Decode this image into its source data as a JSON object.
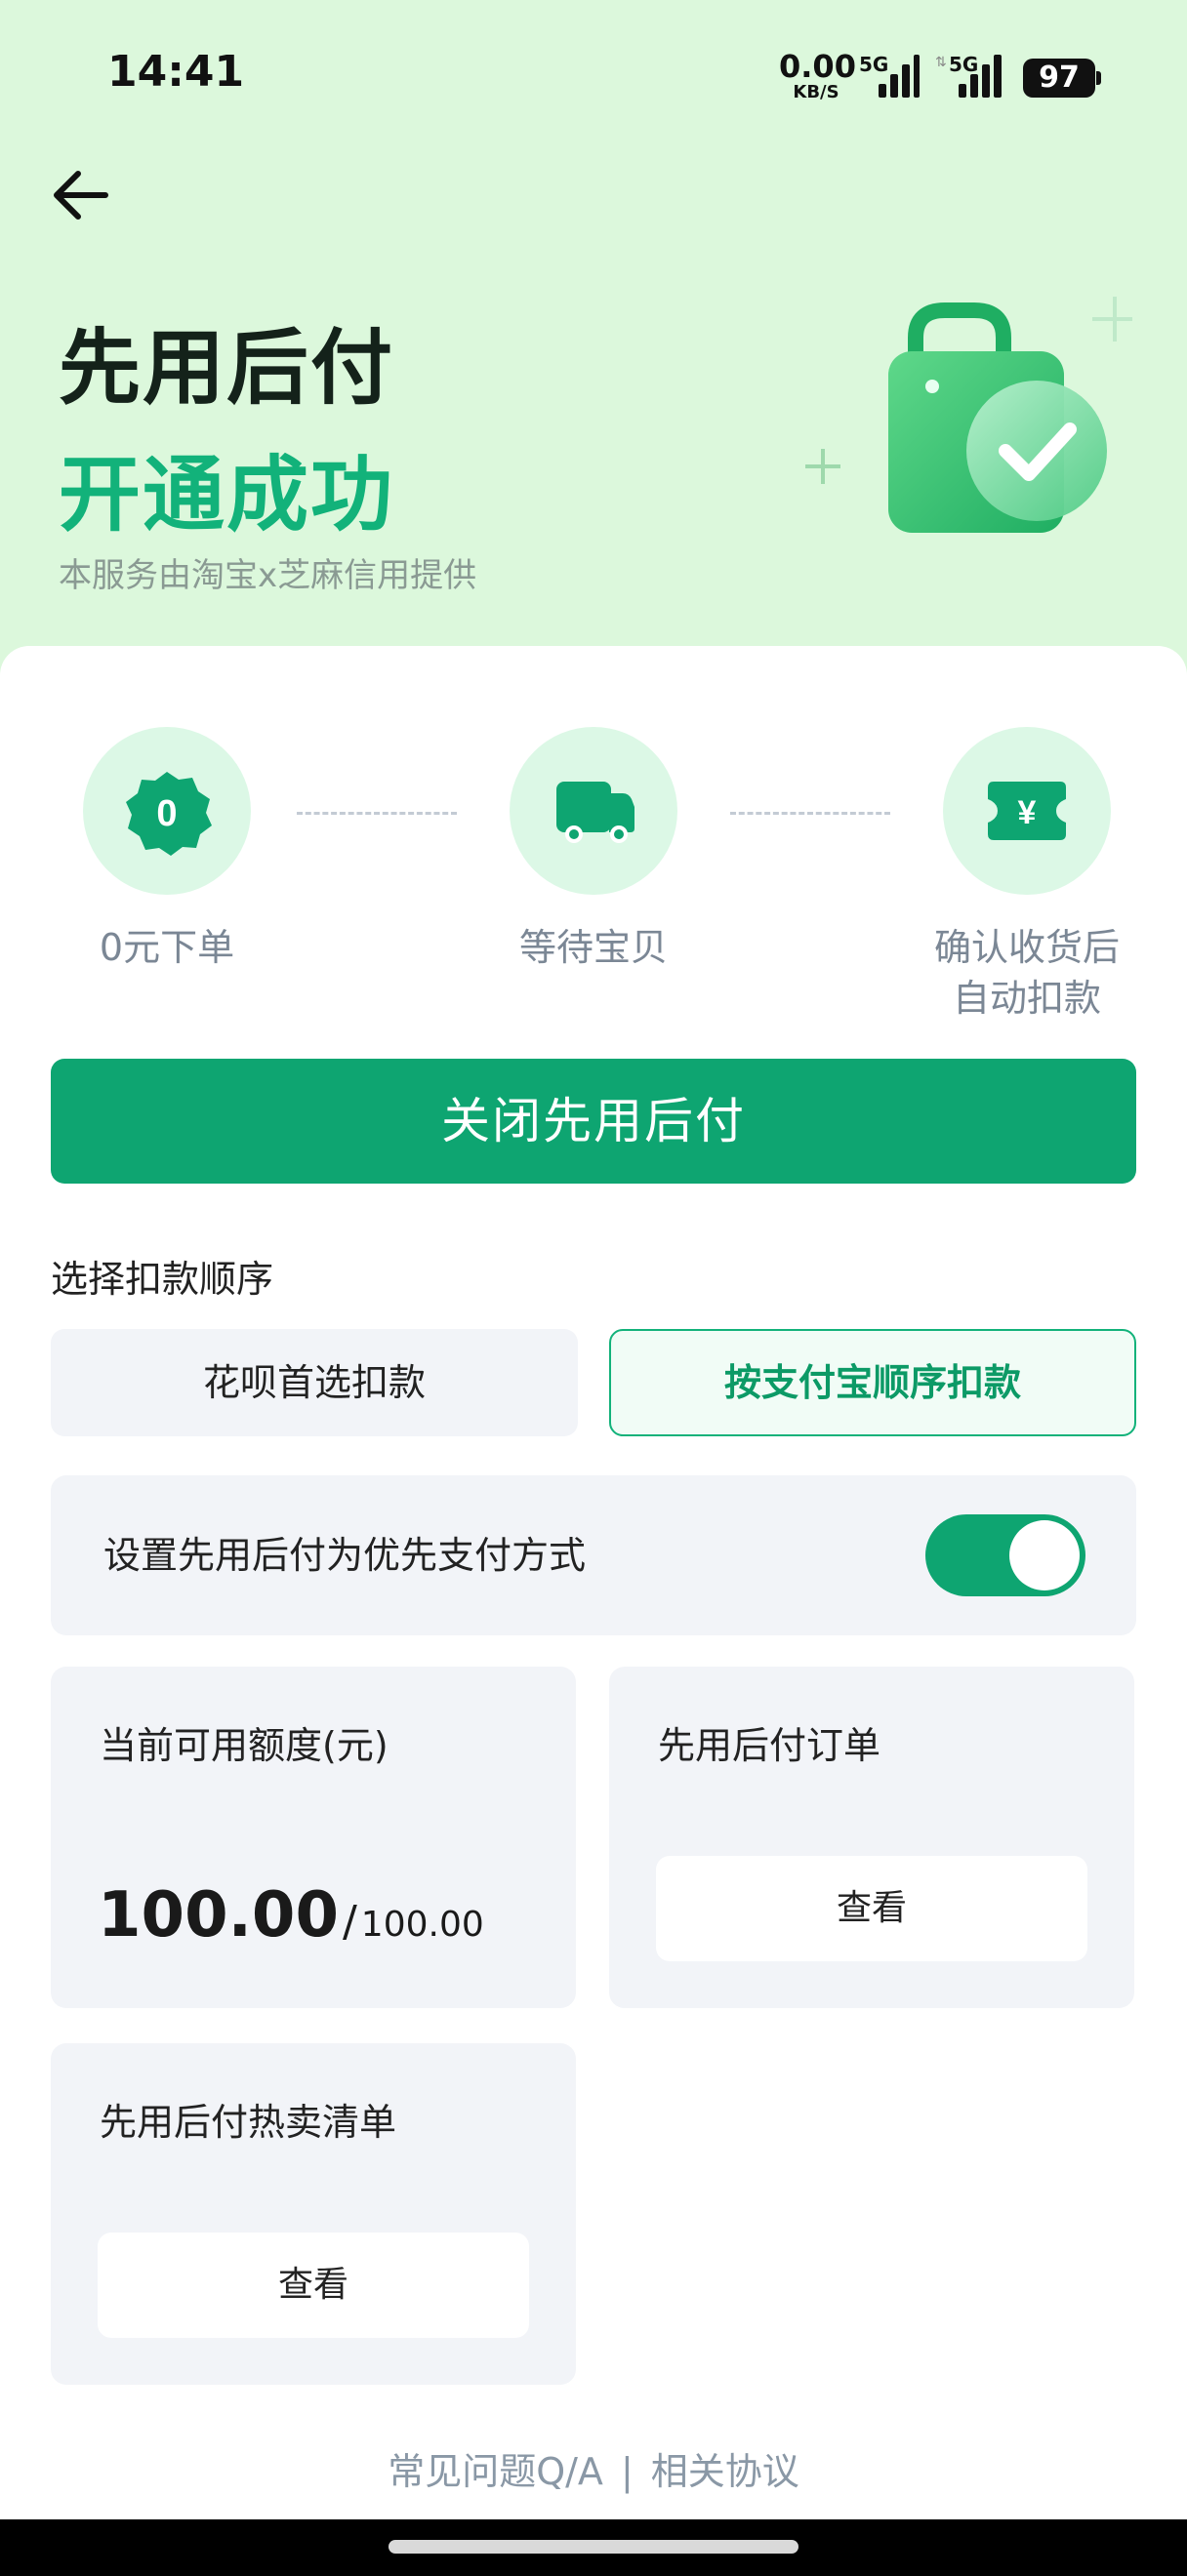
{
  "status_bar": {
    "time": "14:41",
    "net_speed_value": "0.00",
    "net_speed_unit": "KB/S",
    "signal_1_label": "5G",
    "signal_2_label": "5G",
    "battery": "97"
  },
  "header": {
    "title_line1": "先用后付",
    "title_line2": "开通成功",
    "subtitle": "本服务由淘宝x芝麻信用提供",
    "illustration_icon": "shopping-bag-check-icon"
  },
  "steps": [
    {
      "icon": "zero-badge-icon",
      "badge_text": "0",
      "label": "0元下单"
    },
    {
      "icon": "truck-icon",
      "label": "等待宝贝"
    },
    {
      "icon": "yuan-ticket-icon",
      "badge_text": "¥",
      "label_line1": "确认收货后",
      "label_line2": "自动扣款"
    }
  ],
  "primary_button": "关闭先用后付",
  "deduction_order": {
    "label": "选择扣款顺序",
    "options": [
      "花呗首选扣款",
      "按支付宝顺序扣款"
    ],
    "selected_index": 1
  },
  "preferred_payment": {
    "label": "设置先用后付为优先支付方式",
    "enabled": true
  },
  "credit_card": {
    "title": "当前可用额度(元)",
    "available": "100.00",
    "separator": "/",
    "total": "100.00"
  },
  "orders_card": {
    "title": "先用后付订单",
    "button": "查看"
  },
  "hot_list_card": {
    "title": "先用后付热卖清单",
    "button": "查看"
  },
  "footer": {
    "faq": "常见问题Q/A",
    "separator": "|",
    "agreements": "相关协议"
  },
  "colors": {
    "accent": "#0ea571",
    "hero_bg": "#dcf8dc",
    "title_green": "#12b27a",
    "card_bg": "#f2f4f8"
  }
}
